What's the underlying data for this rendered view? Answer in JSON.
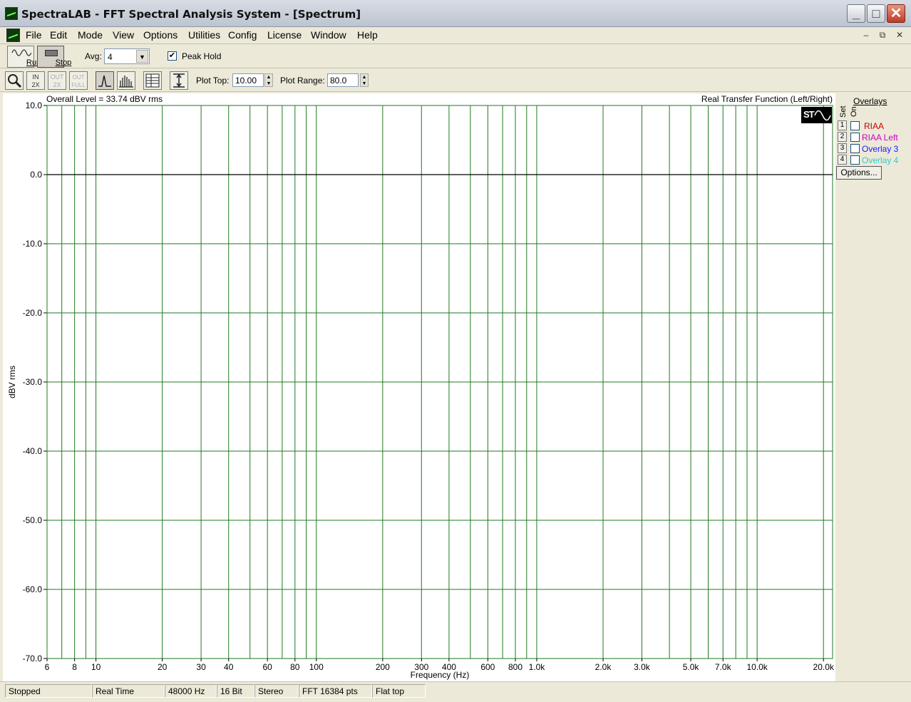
{
  "window": {
    "title": "SpectraLAB - FFT Spectral Analysis System - [Spectrum]",
    "min_glyph": "_",
    "max_glyph": "□",
    "close_glyph": "✕"
  },
  "menu": {
    "items": [
      "File",
      "Edit",
      "Mode",
      "View",
      "Options",
      "Utilities",
      "Config",
      "License",
      "Window",
      "Help"
    ],
    "mdi": [
      "–",
      "⧉",
      "✕"
    ]
  },
  "toolbar1": {
    "run_label": "Run",
    "stop_label": "Stop",
    "avg_label": "Avg:",
    "avg_value": "4",
    "peak_hold_label": "Peak Hold",
    "peak_hold_checked": true
  },
  "toolbar2": {
    "plot_top_label": "Plot Top:",
    "plot_top_value": "10.00",
    "plot_range_label": "Plot Range:",
    "plot_range_value": "80.0",
    "icons": [
      "zoom-icon",
      "zoom-in-2x-icon",
      "zoom-out-2x-icon",
      "zoom-out-full-icon",
      "line-plot-icon",
      "bar-plot-icon",
      "table-icon",
      "autoscale-icon"
    ],
    "icon_text": [
      "",
      "IN\n2X",
      "OUT\n2X",
      "OUT\nFULL",
      "",
      "",
      "",
      ""
    ]
  },
  "plot": {
    "overall_level": "Overall Level = 33.74 dBV rms",
    "function_title": "Real Transfer Function (Left/Right)",
    "logo_text": "ST"
  },
  "overlays": {
    "title": "Overlays",
    "set_header": "Set",
    "on_header": "On",
    "rows": [
      {
        "num": "1",
        "label": "RIAA",
        "color": "#cc0000"
      },
      {
        "num": "2",
        "label": "RIAA Left",
        "color": "#cc00cc"
      },
      {
        "num": "3",
        "label": "Overlay 3",
        "color": "#1a1aff"
      },
      {
        "num": "4",
        "label": "Overlay 4",
        "color": "#33cccc"
      }
    ],
    "options_label": "Options..."
  },
  "status": [
    "Stopped",
    "Real Time",
    "48000 Hz",
    "16 Bit",
    "Stereo",
    "FFT 16384 pts",
    "Flat top"
  ],
  "chart_data": {
    "type": "line",
    "title": "Real Transfer Function (Left/Right)",
    "xlabel": "Frequency (Hz)",
    "ylabel": "dBV rms",
    "x_scale": "log",
    "xlim": [
      6,
      22000
    ],
    "ylim": [
      -70,
      10
    ],
    "y_ticks": [
      10,
      0,
      -10,
      -20,
      -30,
      -40,
      -50,
      -60,
      -70
    ],
    "y_tick_labels": [
      "10.0",
      "0.0",
      "-10.0",
      "-20.0",
      "-30.0",
      "-40.0",
      "-50.0",
      "-60.0",
      "-70.0"
    ],
    "x_ticks": [
      6,
      8,
      10,
      20,
      30,
      40,
      60,
      80,
      100,
      200,
      300,
      400,
      600,
      800,
      1000,
      2000,
      3000,
      5000,
      7000,
      10000,
      20000
    ],
    "x_tick_labels": [
      "6",
      "8",
      "10",
      "20",
      "30",
      "40",
      "60",
      "80",
      "100",
      "200",
      "300",
      "400",
      "600",
      "800",
      "1.0k",
      "2.0k",
      "3.0k",
      "5.0k",
      "7.0k",
      "10.0k",
      "20.0k"
    ],
    "x_gridlines": [
      6,
      7,
      8,
      9,
      10,
      20,
      30,
      40,
      50,
      60,
      70,
      80,
      90,
      100,
      200,
      300,
      400,
      500,
      600,
      700,
      800,
      900,
      1000,
      2000,
      3000,
      4000,
      5000,
      6000,
      7000,
      8000,
      9000,
      10000,
      20000
    ],
    "grid": true,
    "grid_color": "#1f7a1f",
    "series": [
      {
        "x": [
          6,
          10,
          100,
          1000,
          10000,
          22000
        ],
        "y": [
          0,
          0,
          0,
          0,
          0,
          0
        ],
        "color": "#000000"
      }
    ]
  }
}
